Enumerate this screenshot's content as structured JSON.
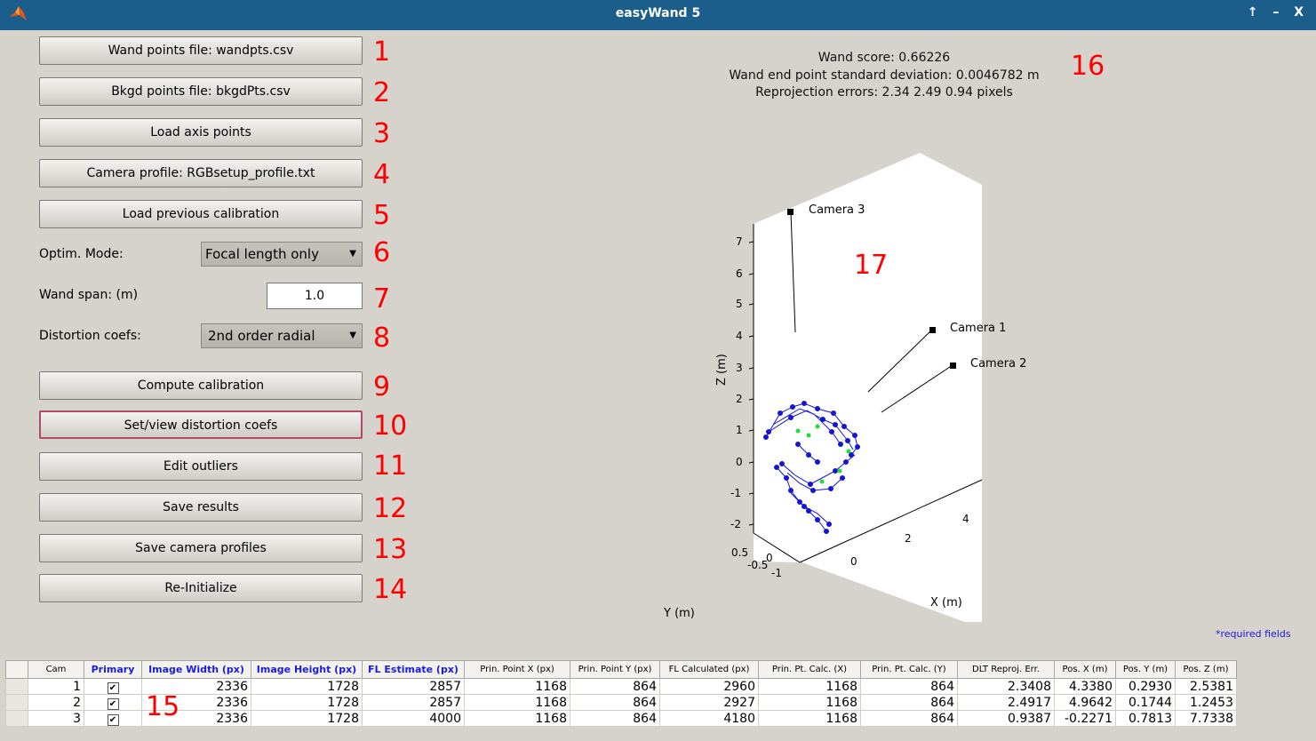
{
  "window": {
    "title": "easyWand 5",
    "controls": "↑ – X"
  },
  "buttons": [
    {
      "label": "Wand points file: wandpts.csv",
      "num": "1"
    },
    {
      "label": "Bkgd points file: bkgdPts.csv",
      "num": "2"
    },
    {
      "label": "Load axis points",
      "num": "3"
    },
    {
      "label": "Camera profile: RGBsetup_profile.txt",
      "num": "4"
    },
    {
      "label": "Load previous calibration",
      "num": "5"
    }
  ],
  "optim": {
    "label": "Optim. Mode:",
    "value": "Focal length only",
    "num": "6"
  },
  "wandspan": {
    "label": "Wand span: (m)",
    "value": "1.0",
    "num": "7"
  },
  "distortion": {
    "label": "Distortion coefs:",
    "value": "2nd order radial",
    "num": "8"
  },
  "buttons2": [
    {
      "label": "Compute calibration",
      "num": "9"
    },
    {
      "label": "Set/view distortion coefs",
      "num": "10"
    },
    {
      "label": "Edit outliers",
      "num": "11"
    },
    {
      "label": "Save results",
      "num": "12"
    },
    {
      "label": "Save camera profiles",
      "num": "13"
    },
    {
      "label": "Re-Initialize",
      "num": "14"
    }
  ],
  "info": {
    "score": "Wand score: 0.66226",
    "std": "Wand end point standard deviation: 0.0046782 m",
    "reproj": "Reprojection errors: 2.34  2.49  0.94   pixels",
    "num": "16"
  },
  "plot": {
    "num": "17",
    "zlabel": "Z (m)",
    "xlabel": "X (m)",
    "ylabel": "Y (m)",
    "zticks": [
      "7",
      "6",
      "5",
      "4",
      "3",
      "2",
      "1",
      "0",
      "-1",
      "-2"
    ],
    "xticks": [
      "0",
      "2",
      "4"
    ],
    "yticks": [
      "0.5",
      "0",
      "-0.5",
      "-1"
    ],
    "cameras": [
      "Camera 3",
      "Camera 1",
      "Camera 2"
    ],
    "colors": {
      "wand": "#1414d8",
      "bkgd": "#22dd33",
      "camera": "#000000"
    }
  },
  "required_note": "*required fields",
  "table": {
    "num": "15",
    "headers": [
      "Cam",
      "Primary",
      "Image Width (px)",
      "Image Height (px)",
      "FL Estimate (px)",
      "Prin. Point X (px)",
      "Prin. Point Y (px)",
      "FL Calculated (px)",
      "Prin. Pt. Calc. (X)",
      "Prin. Pt. Calc. (Y)",
      "DLT Reproj. Err.",
      "Pos. X (m)",
      "Pos. Y (m)",
      "Pos. Z (m)"
    ],
    "required_cols": [
      1,
      2,
      3,
      4
    ],
    "rows": [
      [
        "1",
        "✔",
        "2336",
        "1728",
        "2857",
        "1168",
        "864",
        "2960",
        "1168",
        "864",
        "2.3408",
        "4.3380",
        "0.2930",
        "2.5381"
      ],
      [
        "2",
        "✔",
        "2336",
        "1728",
        "2857",
        "1168",
        "864",
        "2927",
        "1168",
        "864",
        "2.4917",
        "4.9642",
        "0.1744",
        "1.2453"
      ],
      [
        "3",
        "✔",
        "2336",
        "1728",
        "4000",
        "1168",
        "864",
        "4180",
        "1168",
        "864",
        "0.9387",
        "-0.2271",
        "0.7813",
        "7.7338"
      ]
    ]
  }
}
